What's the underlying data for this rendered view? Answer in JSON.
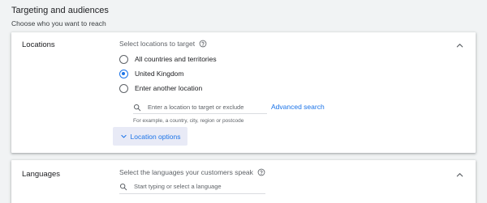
{
  "header": {
    "title": "Targeting and audiences",
    "subtitle": "Choose who you want to reach"
  },
  "locations": {
    "label": "Locations",
    "prompt": "Select locations to target",
    "options": [
      {
        "label": "All countries and territories",
        "checked": false
      },
      {
        "label": "United Kingdom",
        "checked": true
      },
      {
        "label": "Enter another location",
        "checked": false
      }
    ],
    "search_placeholder": "Enter a location to target or exclude",
    "advanced_search": "Advanced search",
    "hint": "For example, a country, city, region or postcode",
    "options_button": "Location options"
  },
  "languages": {
    "label": "Languages",
    "prompt": "Select the languages your customers speak",
    "search_placeholder": "Start typing or select a language"
  },
  "icons": {
    "help": "help-circle-icon",
    "search": "search-icon",
    "collapse": "chevron-up-icon",
    "expand": "chevron-down-icon"
  },
  "colors": {
    "accent": "#1a73e8",
    "background": "#f1f3f4",
    "button_bg": "#e8eaf6"
  }
}
